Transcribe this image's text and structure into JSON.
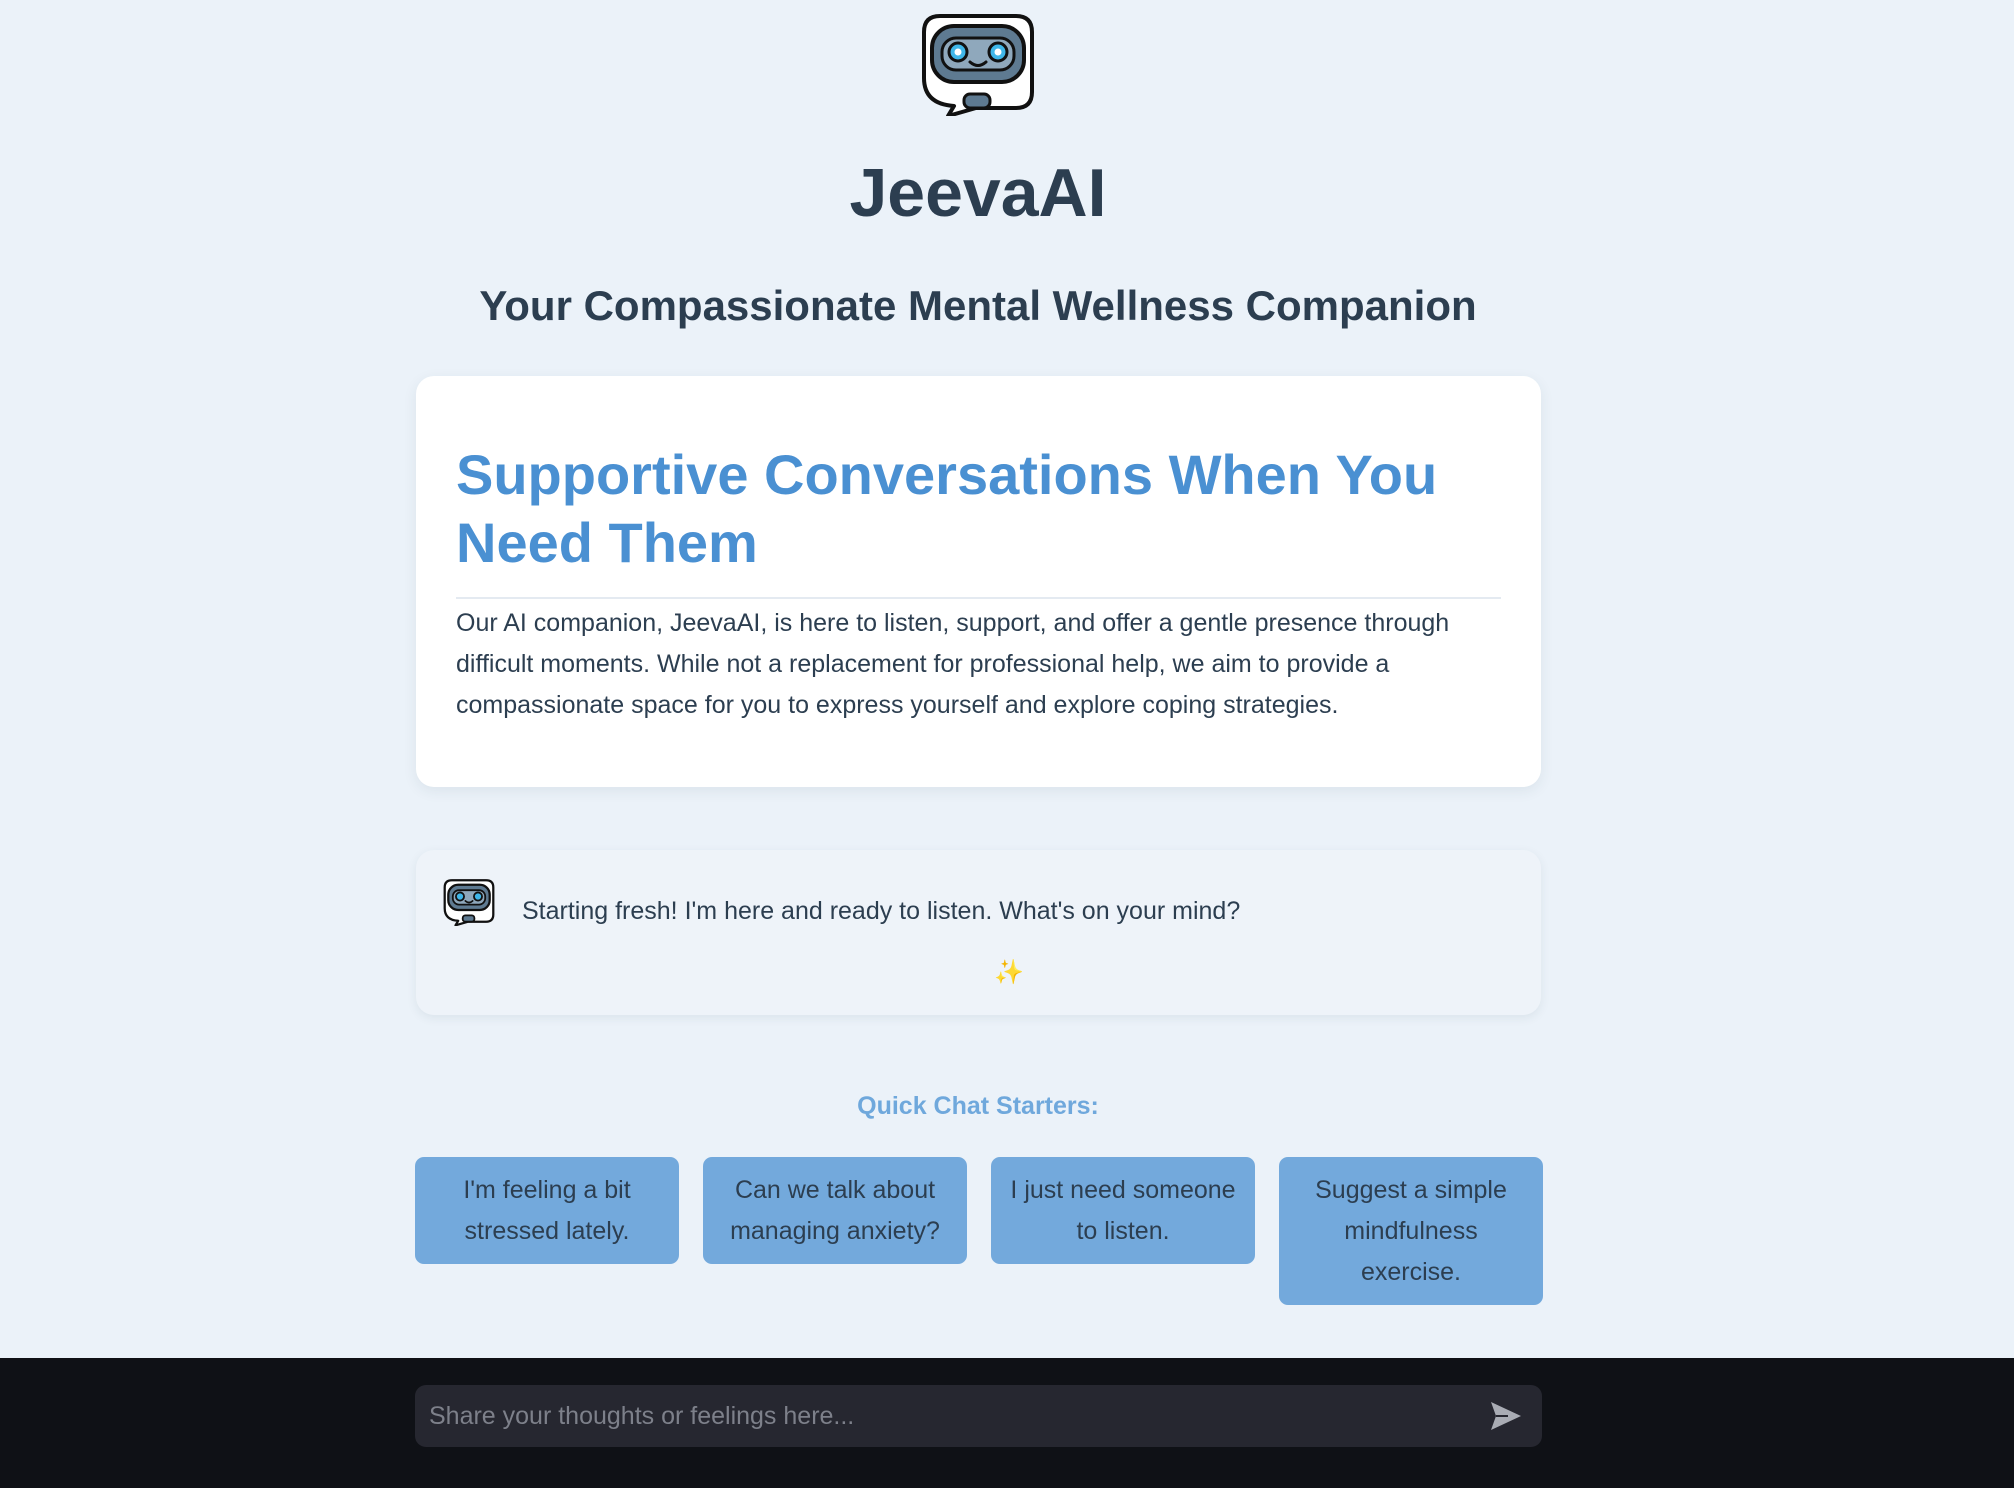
{
  "header": {
    "logo_icon": "robot-chat-bubble-icon",
    "title": "JeevaAI",
    "subtitle": "Your Compassionate Mental Wellness Companion"
  },
  "intro": {
    "heading": "Supportive Conversations When You Need Them",
    "body": "Our AI companion, JeevaAI, is here to listen, support, and offer a gentle presence through difficult moments. While not a replacement for professional help, we aim to provide a compassionate space for you to express yourself and explore coping strategies."
  },
  "chat": {
    "messages": [
      {
        "avatar_icon": "robot-chat-bubble-icon",
        "text": "Starting fresh! I'm here and ready to listen. What's on your mind?",
        "decoration": "✨"
      }
    ]
  },
  "starters": {
    "label": "Quick Chat Starters:",
    "items": [
      "I'm feeling a bit stressed lately.",
      "Can we talk about managing anxiety?",
      "I just need someone to listen.",
      "Suggest a simple mindfulness exercise."
    ]
  },
  "input": {
    "placeholder": "Share your thoughts or feelings here...",
    "value": "",
    "send_icon": "send-arrow-icon"
  },
  "colors": {
    "page_background": "#EBF2F9",
    "heading_text": "#2C3E50",
    "accent_blue": "#4A90D2",
    "starter_button": "#73A9DC",
    "bottom_bar": "#0F1116",
    "input_background": "#262730"
  }
}
